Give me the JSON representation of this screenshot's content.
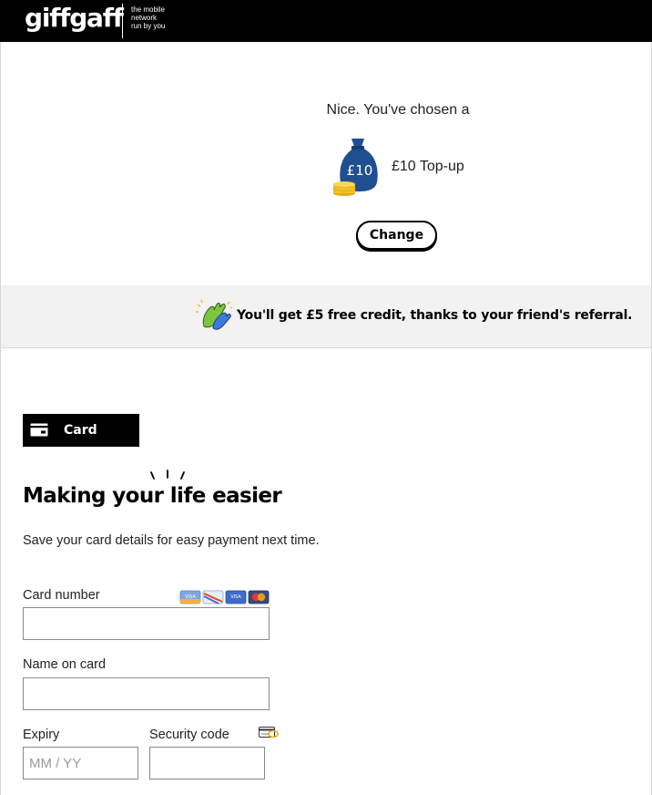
{
  "header": {
    "logo": "giffgaff",
    "tagline": [
      "the mobile",
      "network",
      "run by you"
    ]
  },
  "selection": {
    "intro": "Nice. You've chosen a",
    "bag_label": "£10",
    "product": "£10 Top-up",
    "change_label": "Change"
  },
  "referral": {
    "text": "You'll get £5 free credit, thanks to your friend's referral.",
    "icon": "clapping-hands-icon"
  },
  "payment": {
    "tab_label": "Card",
    "heading": "Making your life easier",
    "subtext": "Save your card details for easy payment next time.",
    "card_number_label": "Card number",
    "card_number_value": "",
    "name_label": "Name on card",
    "name_value": "",
    "expiry_label": "Expiry",
    "expiry_placeholder": "MM / YY",
    "security_label": "Security code",
    "security_value": "",
    "accepted_cards": [
      "VISA",
      "Maestro",
      "VISA Electron",
      "Mastercard"
    ]
  },
  "colors": {
    "header_bg": "#000000",
    "bag_blue": "#1f4f8f",
    "coin_gold": "#f2c12e",
    "banner_bg": "#f2f2f2",
    "hand_green": "#7ec43f",
    "hand_blue": "#3a7bd5"
  }
}
